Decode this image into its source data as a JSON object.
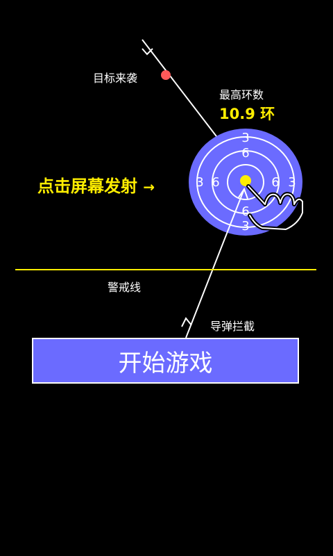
{
  "hint": {
    "incoming_target": "目标来袭",
    "tap_to_fire": "点击屏幕发射",
    "tap_arrow": "→",
    "intercept": "导弹拦截",
    "warning_line": "警戒线"
  },
  "score": {
    "label": "最高环数",
    "value": "10.9 环"
  },
  "target": {
    "outer_ring": "3",
    "inner_ring": "6"
  },
  "start_button": {
    "label": "开始游戏"
  },
  "colors": {
    "background": "#000000",
    "target_blue": "#6b6bff",
    "highlight": "#ffee00",
    "enemy": "#ff5a5a"
  }
}
